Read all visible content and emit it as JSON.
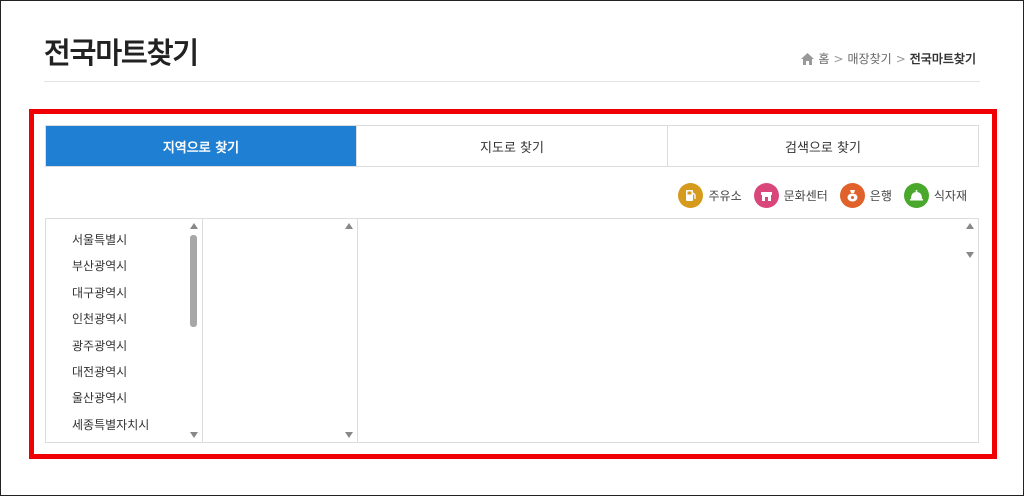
{
  "header": {
    "title": "전국마트찾기",
    "breadcrumb": {
      "home": "홈",
      "level1": "매장찾기",
      "current": "전국마트찾기"
    }
  },
  "tabs": [
    {
      "label": "지역으로 찾기",
      "active": true
    },
    {
      "label": "지도로 찾기",
      "active": false
    },
    {
      "label": "검색으로 찾기",
      "active": false
    }
  ],
  "legend": [
    {
      "label": "주유소",
      "icon": "fuel-pump-icon",
      "color": "#d69a1c"
    },
    {
      "label": "문화센터",
      "icon": "store-icon",
      "color": "#d9477a"
    },
    {
      "label": "은행",
      "icon": "bank-icon",
      "color": "#e0612a"
    },
    {
      "label": "식자재",
      "icon": "cloche-icon",
      "color": "#4aa82c"
    }
  ],
  "regions": [
    "서울특별시",
    "부산광역시",
    "대구광역시",
    "인천광역시",
    "광주광역시",
    "대전광역시",
    "울산광역시",
    "세종특별자치시"
  ],
  "colors": {
    "accent": "#1e7fd3",
    "highlight": "#f00000"
  }
}
